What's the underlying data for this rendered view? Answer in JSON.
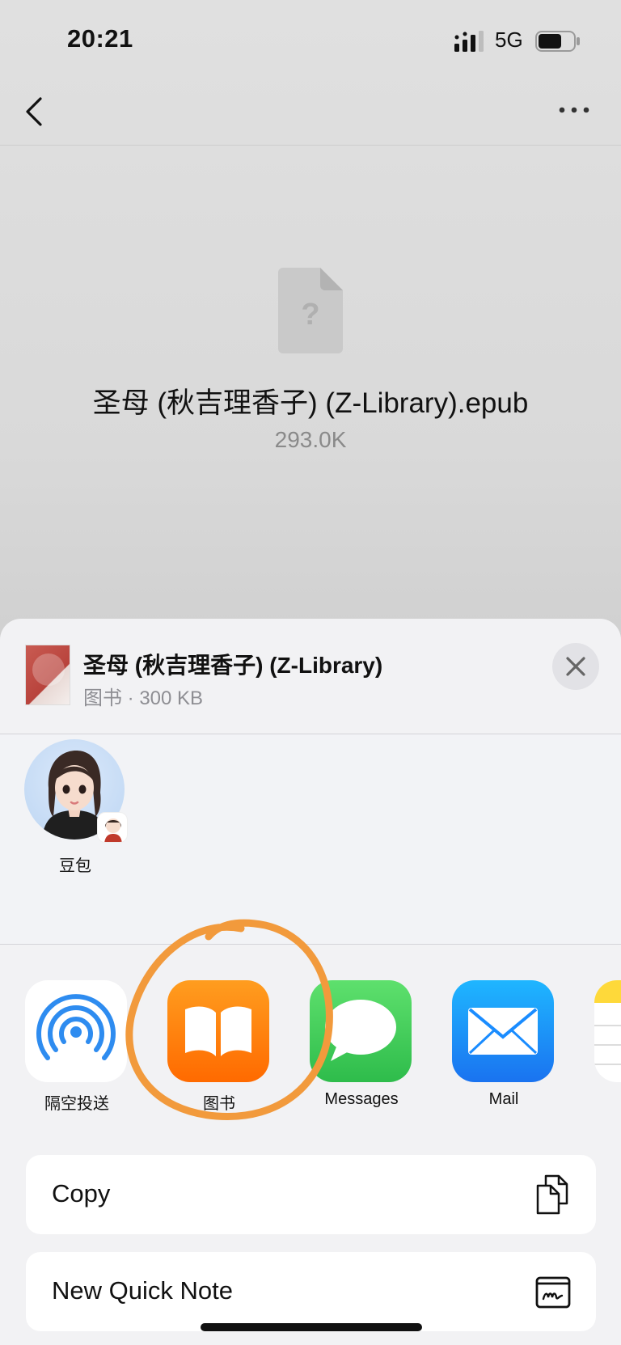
{
  "status_bar": {
    "time": "20:21",
    "network": "5G",
    "icons": [
      "signal-icon",
      "battery-icon"
    ]
  },
  "nav": {
    "back_icon": "chevron-left-icon",
    "more_icon": "ellipsis-icon"
  },
  "file": {
    "icon": "unknown-file-icon",
    "icon_glyph": "?",
    "name": "圣母 (秋吉理香子) (Z-Library).epub",
    "size": "293.0K"
  },
  "share_sheet": {
    "title": "圣母 (秋吉理香子) (Z-Library)",
    "subtitle": "图书 · 300 KB",
    "close_icon": "close-icon",
    "contacts": [
      {
        "label": "豆包"
      }
    ],
    "apps": [
      {
        "label": "隔空投送",
        "icon": "airdrop-icon"
      },
      {
        "label": "图书",
        "icon": "books-icon"
      },
      {
        "label": "Messages",
        "icon": "messages-icon"
      },
      {
        "label": "Mail",
        "icon": "mail-icon"
      },
      {
        "label": "",
        "icon": "notes-icon"
      }
    ],
    "actions": [
      {
        "label": "Copy",
        "icon": "copy-icon"
      },
      {
        "label": "New Quick Note",
        "icon": "quick-note-icon"
      }
    ]
  },
  "colors": {
    "annotation": "#f29a3c",
    "books_orange": "#ff8a00",
    "airdrop_blue": "#2e8cf0",
    "messages_green": "#34c759",
    "mail_blue": "#1a8cff"
  }
}
